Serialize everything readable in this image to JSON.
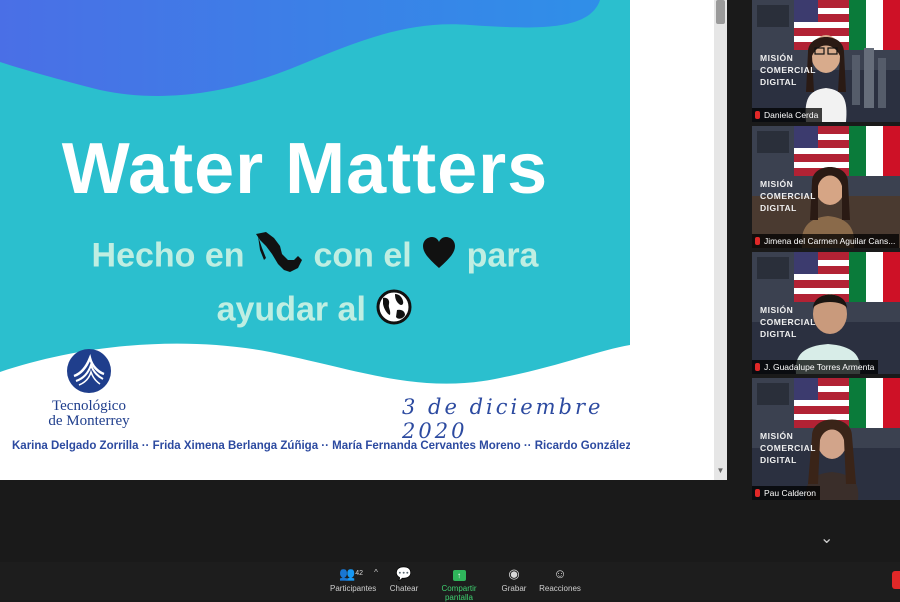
{
  "slide": {
    "title": "Water Matters",
    "line1_part1": "Hecho en",
    "line1_part2": "con el",
    "line1_part3": "para",
    "line2": "ayudar al",
    "logo_line1": "Tecnológico",
    "logo_line2": "de Monterrey",
    "date": "3 de diciembre 2020",
    "authors": "Karina Delgado Zorrilla ·· Frida Ximena Berlanga Zúñiga ·· María Fernanda Cervantes Moreno ·· Ricardo González Olivares",
    "icons": [
      "mexico-map-icon",
      "heart-icon",
      "globe-icon"
    ]
  },
  "background_text": {
    "line1": "MISIÓN",
    "line2": "COMERCIAL",
    "line3": "DIGITAL"
  },
  "participants": [
    {
      "name": "Daniela Cerda"
    },
    {
      "name": "Jimena del Carmen Aguilar Cans..."
    },
    {
      "name": "J. Guadalupe Torres Armenta"
    },
    {
      "name": "Pau Calderon"
    }
  ],
  "toolbar": {
    "participants_label": "Participantes",
    "participants_count": "42",
    "chat_label": "Chatear",
    "share_label": "Compartir pantalla",
    "record_label": "Grabar",
    "reactions_label": "Reacciones"
  },
  "colors": {
    "slide_teal": "#2bbfce",
    "wave_blue": "#3a6fe0",
    "title_white": "#ffffff",
    "subtitle_mint": "#bfeee2",
    "brand_blue": "#1f3e8c",
    "share_green": "#2fb55b",
    "mic_red": "#e02828"
  }
}
